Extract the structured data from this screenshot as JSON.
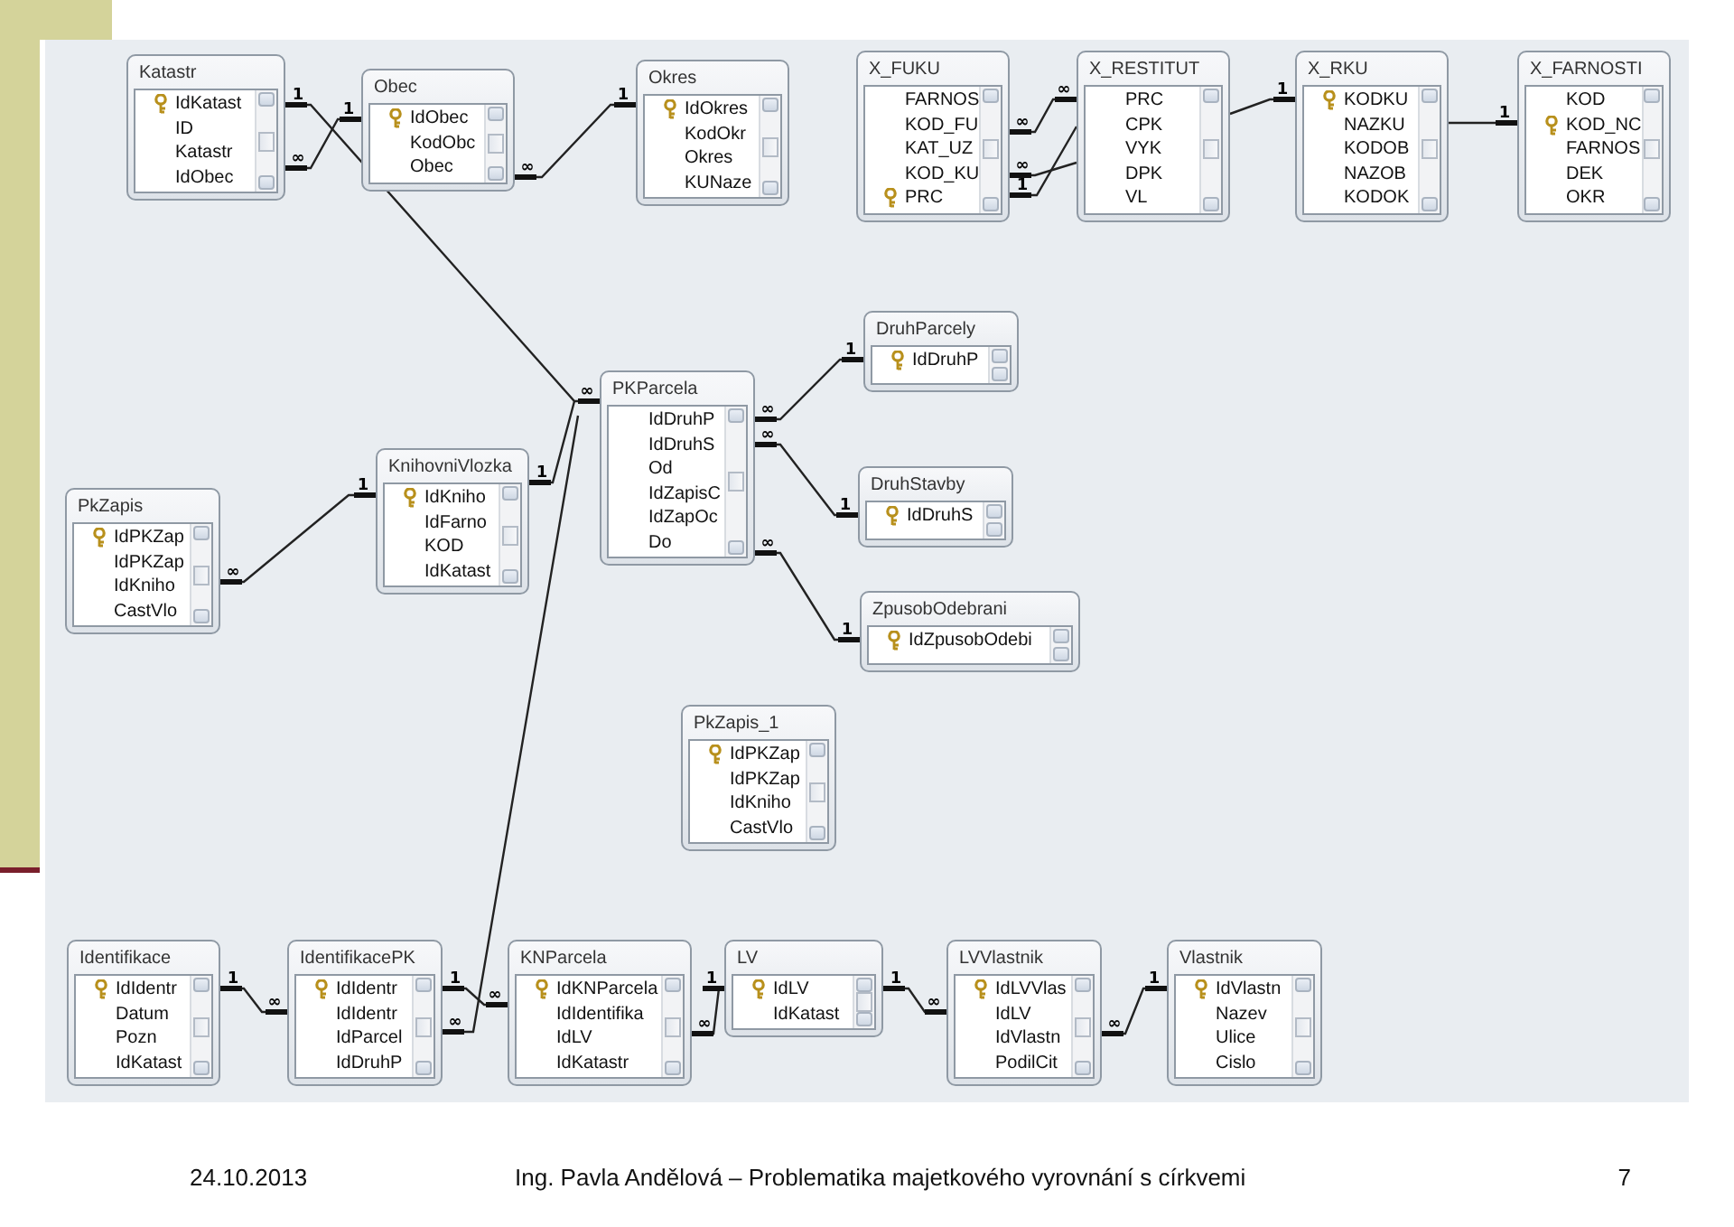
{
  "diagram": {
    "tables": [
      {
        "title": "Katastr",
        "fields": [
          {
            "name": "IdKatast",
            "key": true
          },
          {
            "name": "ID",
            "key": false
          },
          {
            "name": "Katastr",
            "key": false
          },
          {
            "name": "IdObec",
            "key": false
          }
        ]
      },
      {
        "title": "Obec",
        "fields": [
          {
            "name": "IdObec",
            "key": true
          },
          {
            "name": "KodObc",
            "key": false
          },
          {
            "name": "Obec",
            "key": false
          }
        ]
      },
      {
        "title": "Okres",
        "fields": [
          {
            "name": "IdOkres",
            "key": true
          },
          {
            "name": "KodOkr",
            "key": false
          },
          {
            "name": "Okres",
            "key": false
          },
          {
            "name": "KUNaze",
            "key": false
          }
        ]
      },
      {
        "title": "X_FUKU",
        "fields": [
          {
            "name": "FARNOS",
            "key": false
          },
          {
            "name": "KOD_FU",
            "key": false
          },
          {
            "name": "KAT_UZ",
            "key": false
          },
          {
            "name": "KOD_KU",
            "key": false
          },
          {
            "name": "PRC",
            "key": true
          }
        ]
      },
      {
        "title": "X_RESTITUT",
        "fields": [
          {
            "name": "PRC",
            "key": false
          },
          {
            "name": "CPK",
            "key": false
          },
          {
            "name": "VYK",
            "key": false
          },
          {
            "name": "DPK",
            "key": false
          },
          {
            "name": "VL",
            "key": false
          }
        ]
      },
      {
        "title": "X_RKU",
        "fields": [
          {
            "name": "KODKU",
            "key": true
          },
          {
            "name": "NAZKU",
            "key": false
          },
          {
            "name": "KODOB",
            "key": false
          },
          {
            "name": "NAZOB",
            "key": false
          },
          {
            "name": "KODOK",
            "key": false
          }
        ]
      },
      {
        "title": "X_FARNOSTI",
        "fields": [
          {
            "name": "KOD",
            "key": false
          },
          {
            "name": "KOD_NC",
            "key": true
          },
          {
            "name": "FARNOS",
            "key": false
          },
          {
            "name": "DEK",
            "key": false
          },
          {
            "name": "OKR",
            "key": false
          }
        ]
      },
      {
        "title": "DruhParcely",
        "fields": [
          {
            "name": "IdDruhP",
            "key": true
          }
        ]
      },
      {
        "title": "PKParcela",
        "fields": [
          {
            "name": "IdDruhP",
            "key": false
          },
          {
            "name": "IdDruhS",
            "key": false
          },
          {
            "name": "Od",
            "key": false
          },
          {
            "name": "IdZapisC",
            "key": false
          },
          {
            "name": "IdZapOc",
            "key": false
          },
          {
            "name": "Do",
            "key": false
          }
        ]
      },
      {
        "title": "DruhStavby",
        "fields": [
          {
            "name": "IdDruhS",
            "key": true
          }
        ]
      },
      {
        "title": "ZpusobOdebrani",
        "fields": [
          {
            "name": "IdZpusobOdebi",
            "key": true
          }
        ]
      },
      {
        "title": "KnihovniVlozka",
        "fields": [
          {
            "name": "IdKniho",
            "key": true
          },
          {
            "name": "IdFarno",
            "key": false
          },
          {
            "name": "KOD",
            "key": false
          },
          {
            "name": "IdKatast",
            "key": false
          }
        ]
      },
      {
        "title": "PkZapis",
        "fields": [
          {
            "name": "IdPKZap",
            "key": true
          },
          {
            "name": "IdPKZap",
            "key": false
          },
          {
            "name": "IdKniho",
            "key": false
          },
          {
            "name": "CastVlo",
            "key": false
          }
        ]
      },
      {
        "title": "PkZapis_1",
        "fields": [
          {
            "name": "IdPKZap",
            "key": true
          },
          {
            "name": "IdPKZap",
            "key": false
          },
          {
            "name": "IdKniho",
            "key": false
          },
          {
            "name": "CastVlo",
            "key": false
          }
        ]
      },
      {
        "title": "Identifikace",
        "fields": [
          {
            "name": "IdIdentr",
            "key": true
          },
          {
            "name": "Datum",
            "key": false
          },
          {
            "name": "Pozn",
            "key": false
          },
          {
            "name": "IdKatast",
            "key": false
          }
        ]
      },
      {
        "title": "IdentifikacePK",
        "fields": [
          {
            "name": "IdIdentr",
            "key": true
          },
          {
            "name": "IdIdentr",
            "key": false
          },
          {
            "name": "IdParcel",
            "key": false
          },
          {
            "name": "IdDruhP",
            "key": false
          }
        ]
      },
      {
        "title": "KNParcela",
        "fields": [
          {
            "name": "IdKNParcela",
            "key": true
          },
          {
            "name": "IdIdentifika",
            "key": false
          },
          {
            "name": "IdLV",
            "key": false
          },
          {
            "name": "IdKatastr",
            "key": false
          }
        ]
      },
      {
        "title": "LV",
        "fields": [
          {
            "name": "IdLV",
            "key": true
          },
          {
            "name": "IdKatast",
            "key": false
          }
        ]
      },
      {
        "title": "LVVlastnik",
        "fields": [
          {
            "name": "IdLVVlas",
            "key": true
          },
          {
            "name": "IdLV",
            "key": false
          },
          {
            "name": "IdVlastn",
            "key": false
          },
          {
            "name": "PodilCit",
            "key": false
          }
        ]
      },
      {
        "title": "Vlastnik",
        "fields": [
          {
            "name": "IdVlastn",
            "key": true
          },
          {
            "name": "Nazev",
            "key": false
          },
          {
            "name": "Ulice",
            "key": false
          },
          {
            "name": "Cislo",
            "key": false
          }
        ]
      }
    ],
    "relationships": [
      {
        "start_label": "1",
        "end_label": "∞"
      },
      {
        "start_label": "∞",
        "end_label": "1"
      },
      {
        "start_label": "∞",
        "end_label": "1"
      },
      {
        "start_label": "∞",
        "end_label": "∞"
      },
      {
        "start_label": "∞"
      },
      {
        "start_label": "1"
      },
      {
        "end_label": "1"
      },
      {
        "end_label": "1"
      },
      {
        "start_label": "∞",
        "end_label": "1"
      },
      {
        "start_label": "∞",
        "end_label": "1"
      },
      {
        "start_label": "∞",
        "end_label": "1"
      },
      {
        "start_label": "∞",
        "end_label": "1"
      },
      {
        "start_label": "1"
      },
      {
        "start_label": "1",
        "end_label": "∞"
      },
      {
        "start_label": "1",
        "end_label": "∞"
      },
      {
        "end_label": "∞"
      },
      {
        "start_label": "∞",
        "end_label": "1"
      },
      {
        "start_label": "1",
        "end_label": "∞"
      },
      {
        "start_label": "∞",
        "end_label": "1"
      }
    ]
  },
  "footer": {
    "date": "24.10.2013",
    "author": "Ing. Pavla Andělová – Problematika majetkového vyrovnání s církvemi",
    "page_number": "7"
  }
}
